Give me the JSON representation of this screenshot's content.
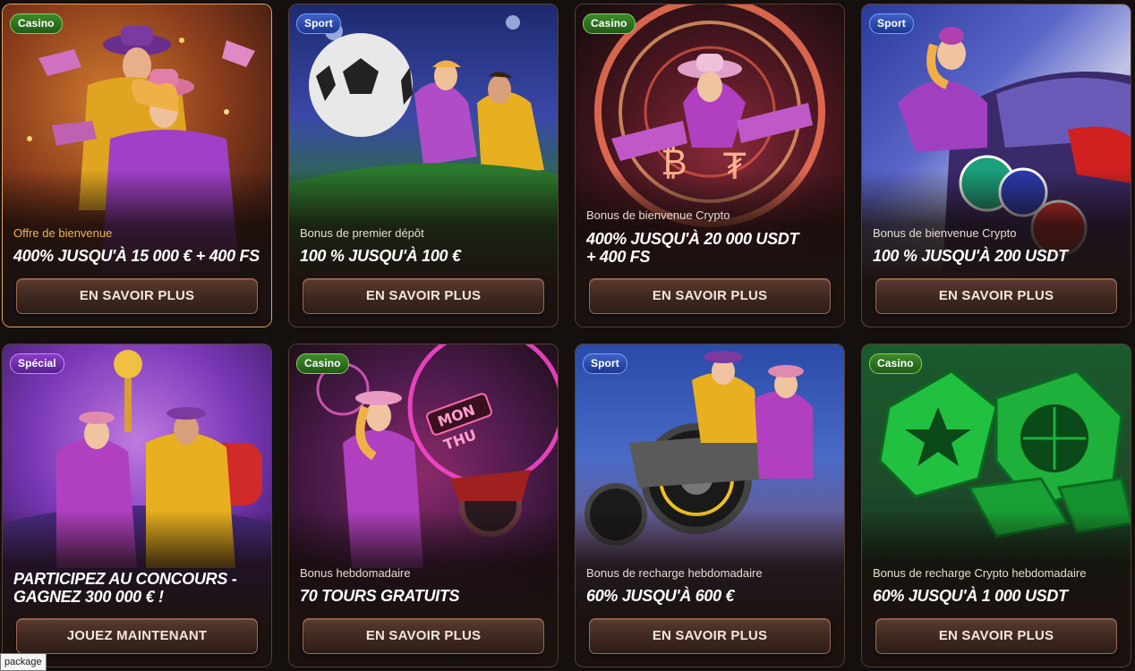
{
  "cards": [
    {
      "badge": "Casino",
      "badge_type": "casino",
      "subtitle": "Offre de bienvenue",
      "subtitle_color": "gold",
      "title": "400% JUSQU'À 15 000 € + 400 FS",
      "button": "EN SAVOIR PLUS",
      "theme": "casino-cowboys-orange"
    },
    {
      "badge": "Sport",
      "badge_type": "sport",
      "subtitle": "Bonus de premier dépôt",
      "title": "100 % JUSQU'À 100 €",
      "button": "EN SAVOIR PLUS",
      "theme": "football-blue"
    },
    {
      "badge": "Casino",
      "badge_type": "casino",
      "subtitle": "Bonus de bienvenue Crypto",
      "title": "400% JUSQU'À 20 000 USDT + 400 FS",
      "button": "EN SAVOIR PLUS",
      "theme": "crypto-roulette-neon"
    },
    {
      "badge": "Sport",
      "badge_type": "sport",
      "subtitle": "Bonus de bienvenue Crypto",
      "title": "100 % JUSQU'À 200 USDT",
      "button": "EN SAVOIR PLUS",
      "theme": "race-car-crypto"
    },
    {
      "badge": "Spécial",
      "badge_type": "special",
      "subtitle": "",
      "title": "PARTICIPEZ AU CONCOURS - GAGNEZ 300 000 € !",
      "button": "JOUEZ MAINTENANT",
      "theme": "contest-purple"
    },
    {
      "badge": "Casino",
      "badge_type": "casino",
      "subtitle": "Bonus hebdomadaire",
      "title": "70 TOURS GRATUITS",
      "button": "EN SAVOIR PLUS",
      "theme": "neon-mon-thu"
    },
    {
      "badge": "Sport",
      "badge_type": "sport",
      "subtitle": "Bonus de recharge hebdomadaire",
      "title": "60% JUSQU'À 600 €",
      "button": "EN SAVOIR PLUS",
      "theme": "quad-bike"
    },
    {
      "badge": "Casino",
      "badge_type": "casino",
      "subtitle": "Bonus de recharge Crypto hebdomadaire",
      "title": "60% JUSQU'À 1 000 USDT",
      "button": "EN SAVOIR PLUS",
      "theme": "green-cubes"
    }
  ],
  "tooltip": "package",
  "neon_sign": [
    "MON",
    "THU"
  ],
  "crypto_symbols": [
    "₿",
    "₮"
  ]
}
